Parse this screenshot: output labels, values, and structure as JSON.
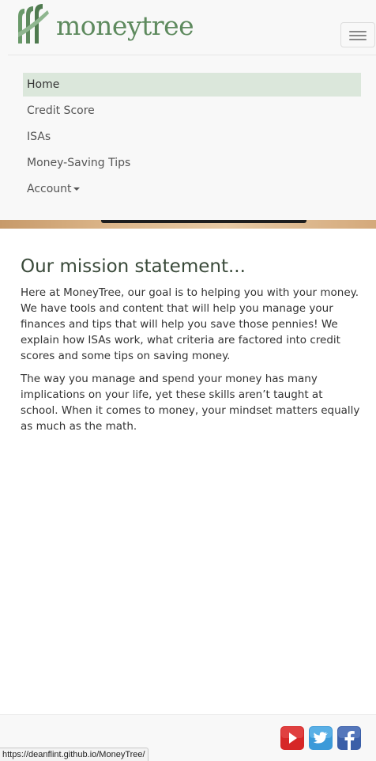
{
  "brand": {
    "name": "moneytree",
    "logo_icon": "tree-logo-icon",
    "logo_color": "#5e8a5e"
  },
  "navbar": {
    "toggle_icon": "hamburger-menu-icon",
    "items": [
      {
        "label": "Home",
        "active": true
      },
      {
        "label": "Credit Score",
        "active": false
      },
      {
        "label": "ISAs",
        "active": false
      },
      {
        "label": "Money-Saving Tips",
        "active": false
      },
      {
        "label": "Account",
        "active": false,
        "dropdown": true
      }
    ]
  },
  "main": {
    "heading": "Our mission statement...",
    "paragraphs": [
      "Here at MoneyTree, our goal is to helping you with your money. We have tools and content that will help you manage your finances and tips that will help you save those pennies! We explain how ISAs work, what criteria are factored into credit scores and some tips on saving money.",
      "The way you manage and spend your money has many implications on your life, yet these skills aren’t taught at school. When it comes to money, your mindset matters equally as much as the math."
    ]
  },
  "footer": {
    "social": [
      {
        "name": "youtube-icon",
        "color": "#d62727"
      },
      {
        "name": "twitter-icon",
        "color": "#3b9ad9"
      },
      {
        "name": "facebook-icon",
        "color": "#3b5fa8"
      }
    ]
  },
  "status_bar": {
    "url": "https://deanflint.github.io/MoneyTree/"
  },
  "colors": {
    "accent": "#5e8a5e",
    "active_nav_bg": "#dbe7db",
    "navbar_bg": "#f8f8f8"
  }
}
